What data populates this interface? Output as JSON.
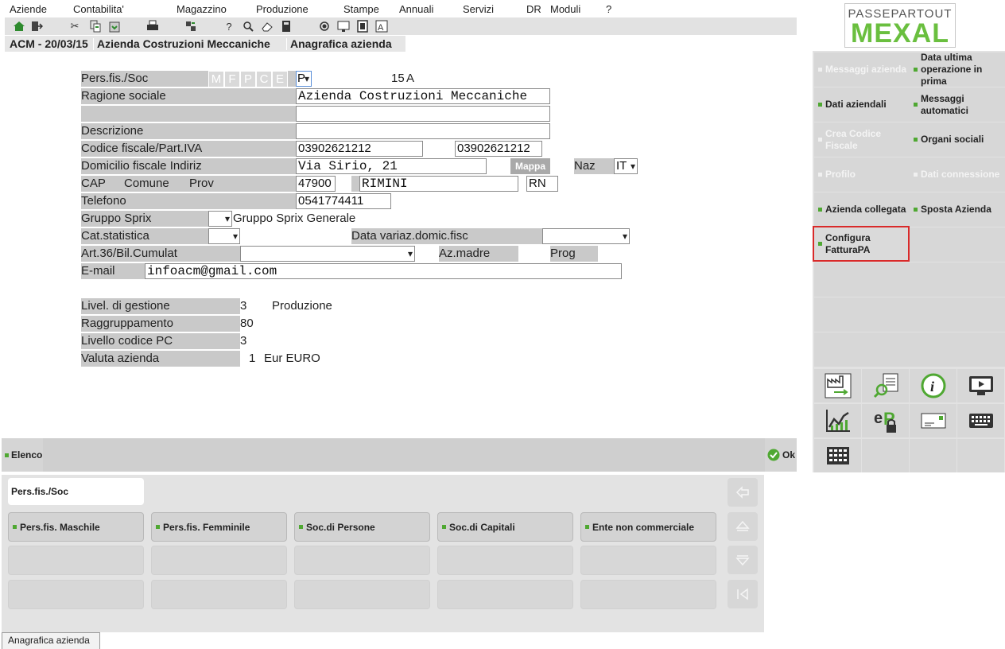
{
  "menu": [
    "Aziende",
    "Contabilita'",
    "Magazzino",
    "Produzione",
    "Stampe",
    "Annuali",
    "Servizi",
    "DR",
    "Moduli",
    "?"
  ],
  "titlebar": {
    "company": "ACM - 20/03/15",
    "company_name": "Azienda Costruzioni Meccaniche",
    "module": "Anagrafica azienda"
  },
  "logo": {
    "top": "PASSEPARTOUT",
    "bottom": "MEXAL"
  },
  "form": {
    "pers_fis_soc": {
      "label": "Pers.fis./Soc",
      "chips": [
        "M",
        "F",
        "P",
        "C",
        "E"
      ],
      "value": "P",
      "code": "15",
      "code_suffix": "A"
    },
    "ragione_sociale": {
      "label": "Ragione sociale",
      "value": "Azienda Costruzioni Meccaniche",
      "value2": ""
    },
    "descrizione": {
      "label": "Descrizione",
      "value": ""
    },
    "codice_fiscale": {
      "label": "Codice fiscale/Part.IVA",
      "cf": "03902621212",
      "piva": "03902621212"
    },
    "domicilio": {
      "label": "Domicilio fiscale Indiriz",
      "value": "Via Sirio, 21",
      "mappa": "Mappa",
      "naz_label": "Naz",
      "naz": "IT"
    },
    "cap_row": {
      "cap_label": "CAP",
      "comune_label": "Comune",
      "prov_label": "Prov",
      "cap": "47900",
      "comune": "RIMINI",
      "prov": "RN"
    },
    "telefono": {
      "label": "Telefono",
      "value": "0541774411"
    },
    "gruppo_sprix": {
      "label": "Gruppo Sprix",
      "value": "",
      "desc": "Gruppo Sprix Generale"
    },
    "cat_statistica": {
      "label": "Cat.statistica",
      "value": ""
    },
    "data_variaz": {
      "label": "Data variaz.domic.fisc",
      "value": ""
    },
    "art36": {
      "label": "Art.36/Bil.Cumulat",
      "value": "",
      "az_madre_label": "Az.madre",
      "prog_label": "Prog"
    },
    "email": {
      "label": "E-mail",
      "value": "infoacm@gmail.com"
    },
    "livel_gestione": {
      "label": "Livel. di gestione",
      "value": "3",
      "desc": "Produzione"
    },
    "raggruppamento": {
      "label": "Raggruppamento",
      "value": "80"
    },
    "livello_pc": {
      "label": "Livello codice PC",
      "value": "3"
    },
    "valuta": {
      "label": "Valuta azienda",
      "value": "1",
      "desc": "Eur EURO"
    }
  },
  "right_panel": {
    "buttons": [
      {
        "label": "Messaggi azienda",
        "enabled": false
      },
      {
        "label": "Data ultima operazione in prima",
        "enabled": true
      },
      {
        "label": "Dati aziendali",
        "enabled": true
      },
      {
        "label": "Messaggi automatici",
        "enabled": true
      },
      {
        "label": "Crea Codice Fiscale",
        "enabled": false
      },
      {
        "label": "Organi sociali",
        "enabled": true
      },
      {
        "label": "Profilo",
        "enabled": false
      },
      {
        "label": "Dati connessione",
        "enabled": false
      },
      {
        "label": "Azienda collegata",
        "enabled": true
      },
      {
        "label": "Sposta Azienda",
        "enabled": true
      },
      {
        "label": "Configura FatturaPA",
        "enabled": true
      }
    ],
    "icons": [
      "factory-transfer-icon",
      "search-document-icon",
      "info-icon",
      "monitor-play-icon",
      "chart-icon",
      "ep-lock-icon",
      "envelope-icon",
      "keyboard-icon",
      "calculator-grid-icon"
    ]
  },
  "bottombar": {
    "elenco": "Elenco",
    "ok": "Ok"
  },
  "selection": {
    "title": "Pers.fis./Soc",
    "options": [
      "Pers.fis. Maschile",
      "Pers.fis. Femminile",
      "Soc.di Persone",
      "Soc.di Capitali",
      "Ente non commerciale"
    ]
  },
  "status_tab": "Anagrafica azienda"
}
